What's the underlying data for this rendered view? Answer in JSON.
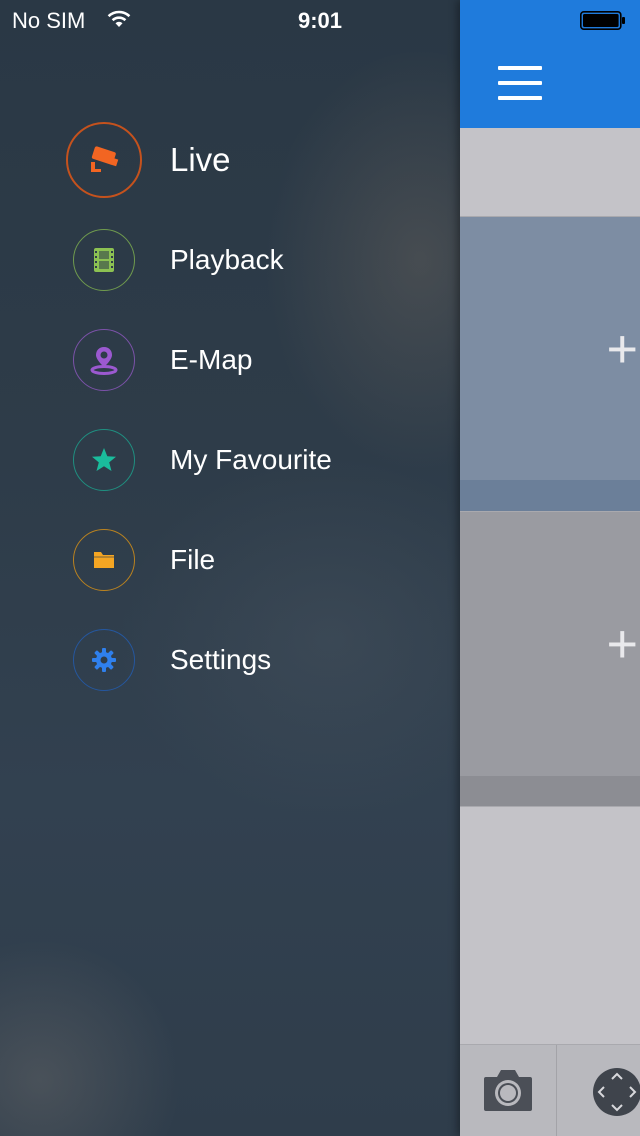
{
  "status_bar": {
    "carrier": "No SIM",
    "time": "9:01"
  },
  "menu": {
    "items": [
      {
        "label": "Live",
        "icon": "cctv-camera-icon",
        "color": "#f26522"
      },
      {
        "label": "Playback",
        "icon": "film-strip-icon",
        "color": "#8cc152"
      },
      {
        "label": "E-Map",
        "icon": "map-pin-icon",
        "color": "#9b59d0"
      },
      {
        "label": "My Favourite",
        "icon": "star-icon",
        "color": "#1abc9c"
      },
      {
        "label": "File",
        "icon": "folder-icon",
        "color": "#f5a623"
      },
      {
        "label": "Settings",
        "icon": "gear-icon",
        "color": "#2f80ed"
      }
    ]
  },
  "main": {
    "nav_color": "#1f7bdc",
    "slots": [
      {
        "label": "+"
      },
      {
        "label": "+"
      }
    ],
    "toolbar": {
      "buttons": [
        "camera-icon",
        "ptz-control-icon"
      ]
    }
  }
}
